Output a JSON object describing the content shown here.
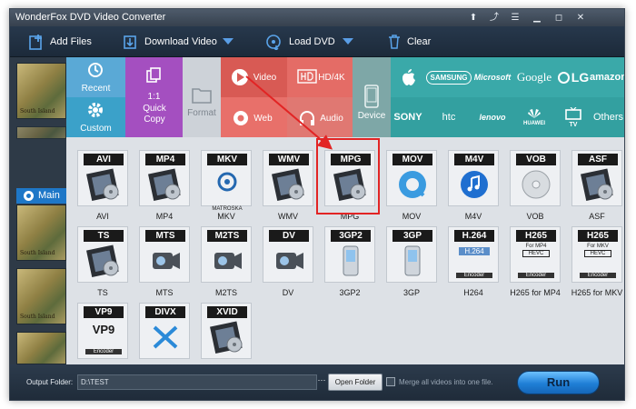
{
  "window": {
    "title": "WonderFox DVD Video Converter"
  },
  "toolbar": {
    "add_files": "Add Files",
    "download_video": "Download Video",
    "load_dvd": "Load DVD",
    "clear": "Clear"
  },
  "left_panel": {
    "main_tab": "Main",
    "thumb_caption": "South Island"
  },
  "categories": {
    "recent": "Recent",
    "custom": "Custom",
    "quick_copy_num": "1:1",
    "quick_copy": "Quick Copy",
    "format": "Format",
    "video": "Video",
    "hd4k": "HD/4K",
    "web": "Web",
    "audio": "Audio",
    "device": "Device"
  },
  "brands": [
    "SAMSUNG",
    "Microsoft",
    "Google",
    "LG",
    "amazon",
    "SONY",
    "htc",
    "lenovo",
    "HUAWEI",
    "TV",
    "Others"
  ],
  "formats": [
    {
      "header": "AVI",
      "name": "AVI"
    },
    {
      "header": "MP4",
      "name": "MP4"
    },
    {
      "header": "MKV",
      "name": "MKV"
    },
    {
      "header": "WMV",
      "name": "WMV"
    },
    {
      "header": "MPG",
      "name": "MPG"
    },
    {
      "header": "MOV",
      "name": "MOV"
    },
    {
      "header": "M4V",
      "name": "M4V"
    },
    {
      "header": "VOB",
      "name": "VOB"
    },
    {
      "header": "ASF",
      "name": "ASF"
    },
    {
      "header": "TS",
      "name": "TS"
    },
    {
      "header": "MTS",
      "name": "MTS"
    },
    {
      "header": "M2TS",
      "name": "M2TS"
    },
    {
      "header": "DV",
      "name": "DV"
    },
    {
      "header": "3GP2",
      "name": "3GP2"
    },
    {
      "header": "3GP",
      "name": "3GP"
    },
    {
      "header": "H.264",
      "name": "H264"
    },
    {
      "header": "H265",
      "name": "H265 for MP4"
    },
    {
      "header": "H265",
      "name": "H265 for MKV"
    },
    {
      "header": "VP9",
      "name": "VP9"
    },
    {
      "header": "DIVX",
      "name": "DIVX"
    },
    {
      "header": "XVID",
      "name": "XVID"
    }
  ],
  "tile_text": {
    "matroska": "MATROSKA",
    "h264": "H.264",
    "encoder": "Encoder",
    "for_mp4": "For MP4",
    "for_mkv": "For MKV",
    "hevc": "HEVC",
    "vp9": "VP9"
  },
  "bottom": {
    "output_folder_label": "Output Folder:",
    "output_folder_value": "D:\\TEST",
    "browse": "···",
    "open_folder": "Open Folder",
    "merge_label": "Merge all videos into one file.",
    "run": "Run"
  },
  "colors": {
    "toolbar_bg": "#1f2d3d",
    "recent_tile": "#5aa9d6",
    "quick_copy_tile": "#a44fc0",
    "format_tile": "#cfd4d9",
    "video_tile": "#e4645f",
    "device_tile": "#7ea7a7",
    "brand_tile": "#3aa9a9",
    "highlight_box": "#e22424",
    "run_button": "#1f7fd6"
  }
}
